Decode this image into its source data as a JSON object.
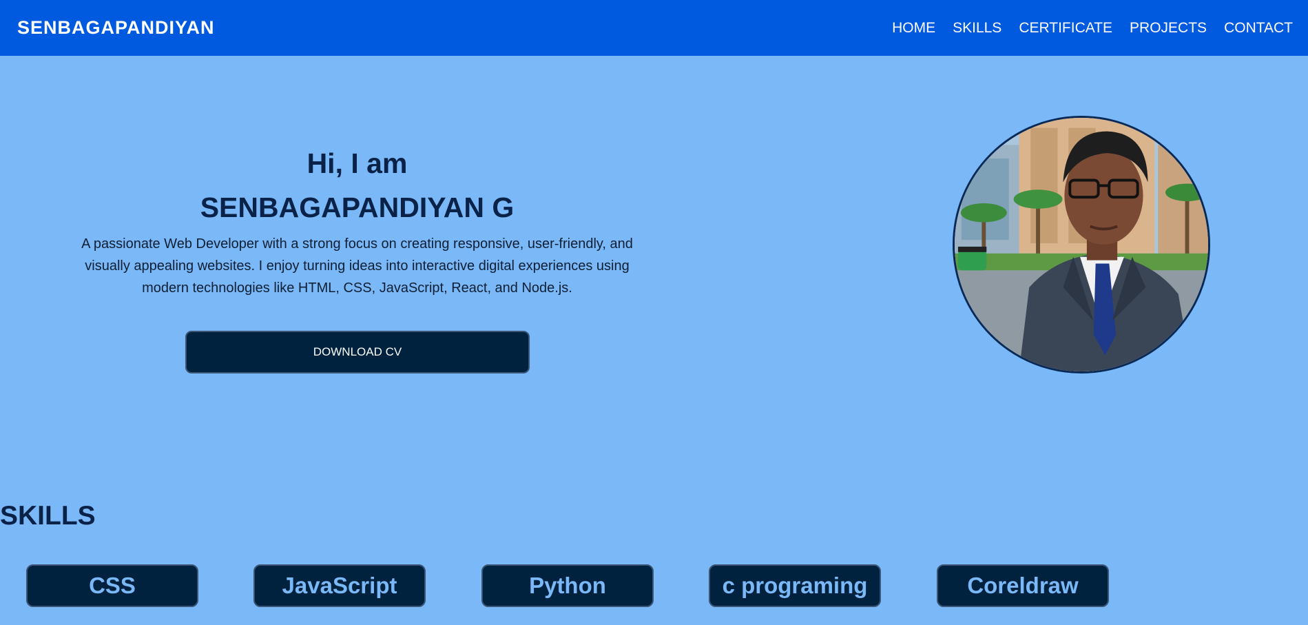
{
  "header": {
    "brand": "SENBAGAPANDIYAN",
    "nav": [
      {
        "label": "HOME"
      },
      {
        "label": "SKILLS"
      },
      {
        "label": "CERTIFICATE"
      },
      {
        "label": "PROJECTS"
      },
      {
        "label": "CONTACT"
      }
    ]
  },
  "hero": {
    "greeting": "Hi, I am",
    "name": "SENBAGAPANDIYAN G",
    "description": "A passionate Web Developer with a strong focus on creating responsive, user-friendly, and visually appealing websites. I enjoy turning ideas into interactive digital experiences using modern technologies like HTML, CSS, JavaScript, React, and Node.js.",
    "cv_button": "DOWNLOAD CV"
  },
  "skills": {
    "heading": "SKILLS",
    "items": [
      {
        "label": "CSS"
      },
      {
        "label": "JavaScript"
      },
      {
        "label": "Python"
      },
      {
        "label": "c programing"
      },
      {
        "label": "Coreldraw"
      }
    ]
  },
  "colors": {
    "navbar": "#005ae0",
    "page_bg": "#7ab8f8",
    "dark_navy": "#00223f",
    "heading_text": "#0a2247"
  }
}
